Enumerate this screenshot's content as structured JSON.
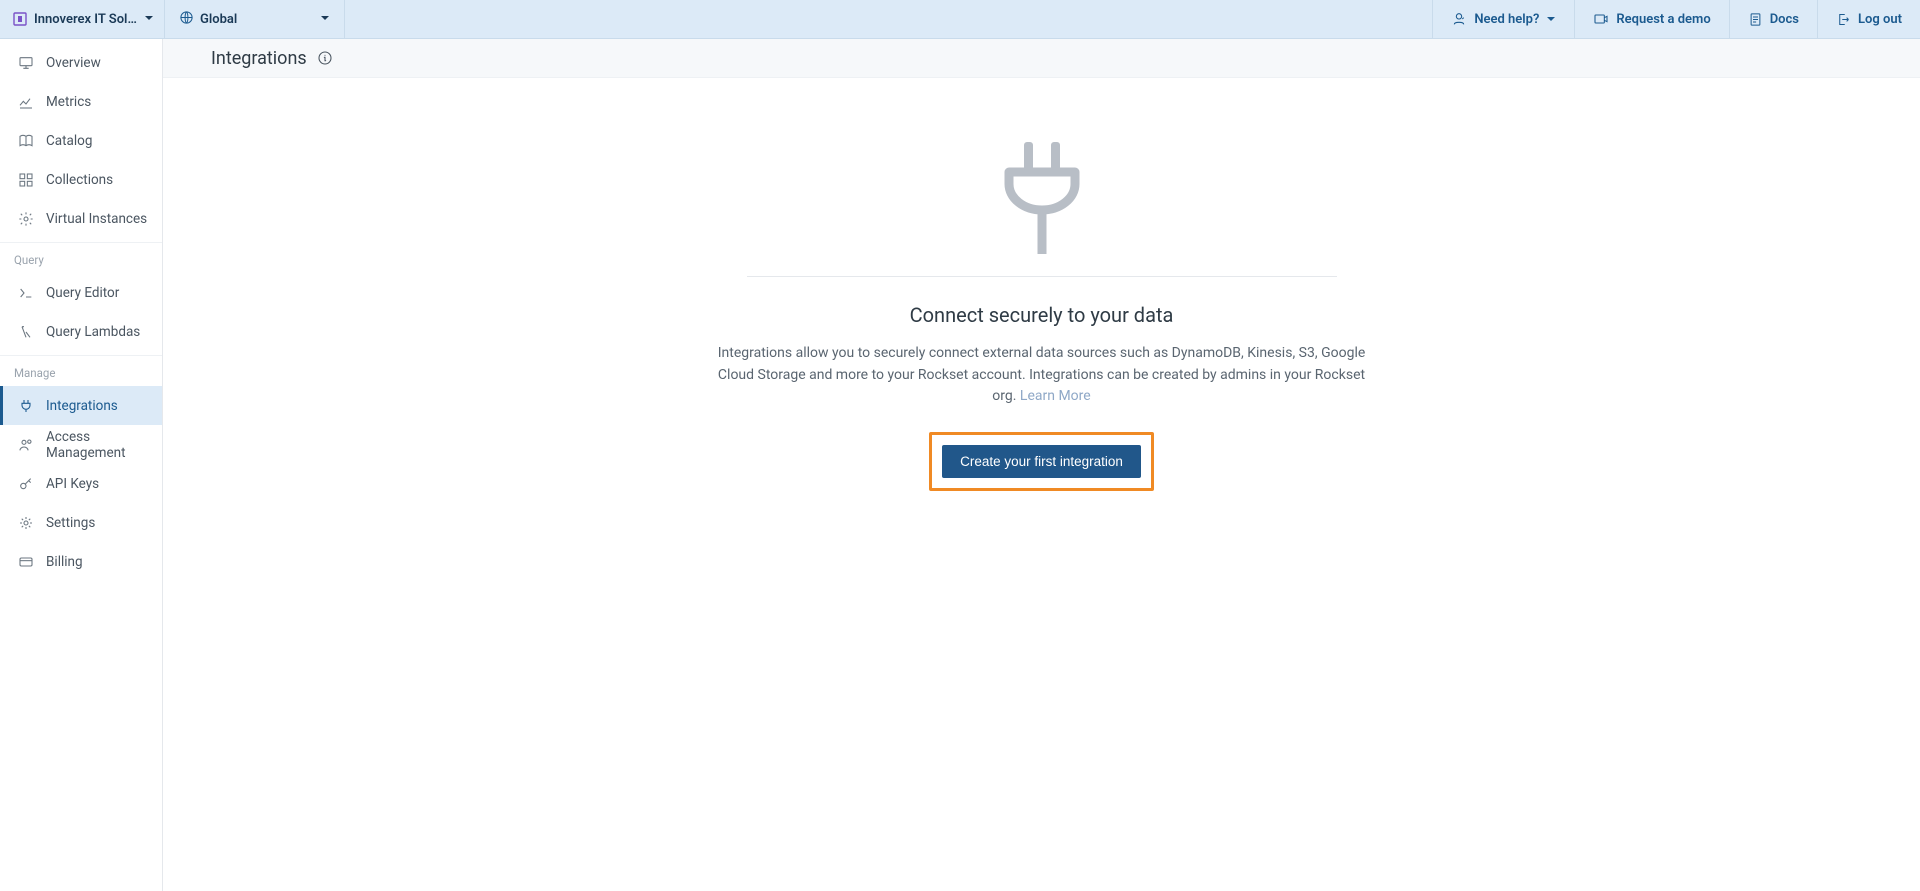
{
  "topbar": {
    "org_name": "Innoverex IT Solution...",
    "region": "Global",
    "need_help": "Need help?",
    "request_demo": "Request a demo",
    "docs": "Docs",
    "logout": "Log out"
  },
  "sidebar": {
    "sections": {
      "query": "Query",
      "manage": "Manage"
    },
    "items": {
      "overview": "Overview",
      "metrics": "Metrics",
      "catalog": "Catalog",
      "collections": "Collections",
      "virtual_instances": "Virtual Instances",
      "query_editor": "Query Editor",
      "query_lambdas": "Query Lambdas",
      "integrations": "Integrations",
      "access_management": "Access Management",
      "api_keys": "API Keys",
      "settings": "Settings",
      "billing": "Billing"
    }
  },
  "page": {
    "title": "Integrations",
    "empty_heading": "Connect securely to your data",
    "empty_desc": "Integrations allow you to securely connect external data sources such as DynamoDB, Kinesis, S3, Google Cloud Storage and more to your Rockset account. Integrations can be created by admins in your Rockset org. ",
    "learn_more": "Learn More",
    "cta": "Create your first integration"
  }
}
